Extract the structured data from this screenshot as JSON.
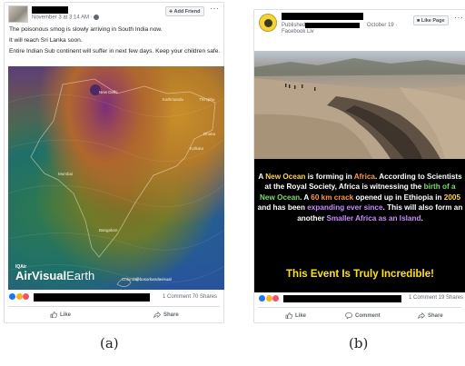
{
  "post_a": {
    "timestamp": "November 3 at 3:14 AM · ",
    "add_friend_label": "Add Friend",
    "more_label": "···",
    "lines": [
      "The poisonous smog is slowly arriving in South India now.",
      "It will reach Sri Lanka soon.",
      "Entire Indian Sub continent will suffer in next few days. Keep your children safe."
    ],
    "map": {
      "labels": [
        "New Delhi",
        "Kathmandu",
        "Thimphu",
        "Dhaka",
        "Kolkata",
        "Mumbai",
        "Bangalore",
        "Colombo"
      ],
      "brand_small": "IQAir",
      "brand_big": "AirVisual",
      "brand_light": "Earth",
      "watermark": "@bosorkandavisual"
    },
    "stats": "1 Comment  70 Shares",
    "actions": {
      "like": "Like",
      "share": "Share"
    },
    "caption": "(a)"
  },
  "post_b": {
    "published_by": "Published b",
    "date": "October 19 · ",
    "page_line": "Facebook Liv",
    "like_page_label": "Like Page",
    "more_label": "···",
    "image_text": {
      "w1": "A ",
      "y1": "New Ocean",
      "w2": " is forming in ",
      "o1": "Africa",
      "w3": ". According to Scientists at the Royal Society, Africa is witnessing the ",
      "g1": "birth of a New Ocean",
      "w4": ". A ",
      "o2": "60 km crack",
      "w5": " opened up in Ethiopia in ",
      "y2": "2005",
      "w6": " and has been ",
      "g2": "expanding ever since",
      "w7": ". This will also form an another ",
      "p1": "Smaller Africa as an Island",
      "w8": "."
    },
    "headline": "This Event Is Truly Incredible!",
    "stats": "1 Comment  19 Shares",
    "actions": {
      "like": "Like",
      "comment": "Comment",
      "share": "Share"
    },
    "caption": "(b)"
  }
}
